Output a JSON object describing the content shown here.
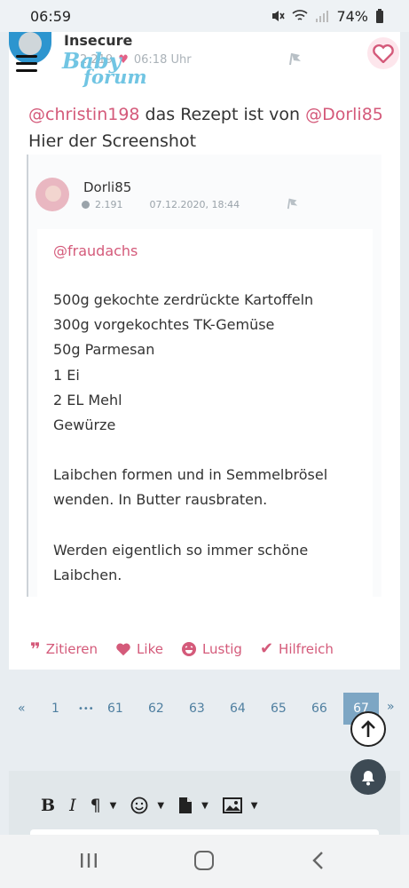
{
  "status_bar": {
    "time": "06:59",
    "battery": "74%"
  },
  "post": {
    "username": "Insecure",
    "count": "2.219",
    "time": "06:18 Uhr",
    "logo": {
      "line1": "Baby",
      "line2": "forum"
    },
    "mention1": "@christin198",
    "text_mid": " das Rezept ist von ",
    "mention2": "@Dorli85",
    "line2": "Hier der Screenshot"
  },
  "quote": {
    "username": "Dorli85",
    "count": "2.191",
    "date": "07.12.2020, 18:44",
    "mention": "@fraudachs",
    "ingredients": [
      "500g gekochte zerdrückte Kartoffeln",
      "300g vorgekochtes TK-Gemüse",
      "50g Parmesan",
      "1 Ei",
      "2 EL Mehl",
      "Gewürze"
    ],
    "instructions": [
      "Laibchen formen und in Semmelbrösel",
      "wenden. In Butter rausbraten."
    ],
    "closing": [
      "Werden eigentlich so immer schöne",
      "Laibchen."
    ]
  },
  "actions": {
    "quote": "Zitieren",
    "like": "Like",
    "funny": "Lustig",
    "helpful": "Hilfreich"
  },
  "pagination": {
    "prev": "«",
    "first": "1",
    "ellipsis": "•••",
    "pages": [
      "61",
      "62",
      "63",
      "64",
      "65",
      "66"
    ],
    "current": "67",
    "next": "»"
  },
  "editor": {
    "bold": "B",
    "italic": "I",
    "paragraph": "¶"
  },
  "colors": {
    "accent": "#d45a7a",
    "link": "#4f7fa0",
    "active_page": "#7da6c4",
    "logo": "#71c5e3"
  }
}
